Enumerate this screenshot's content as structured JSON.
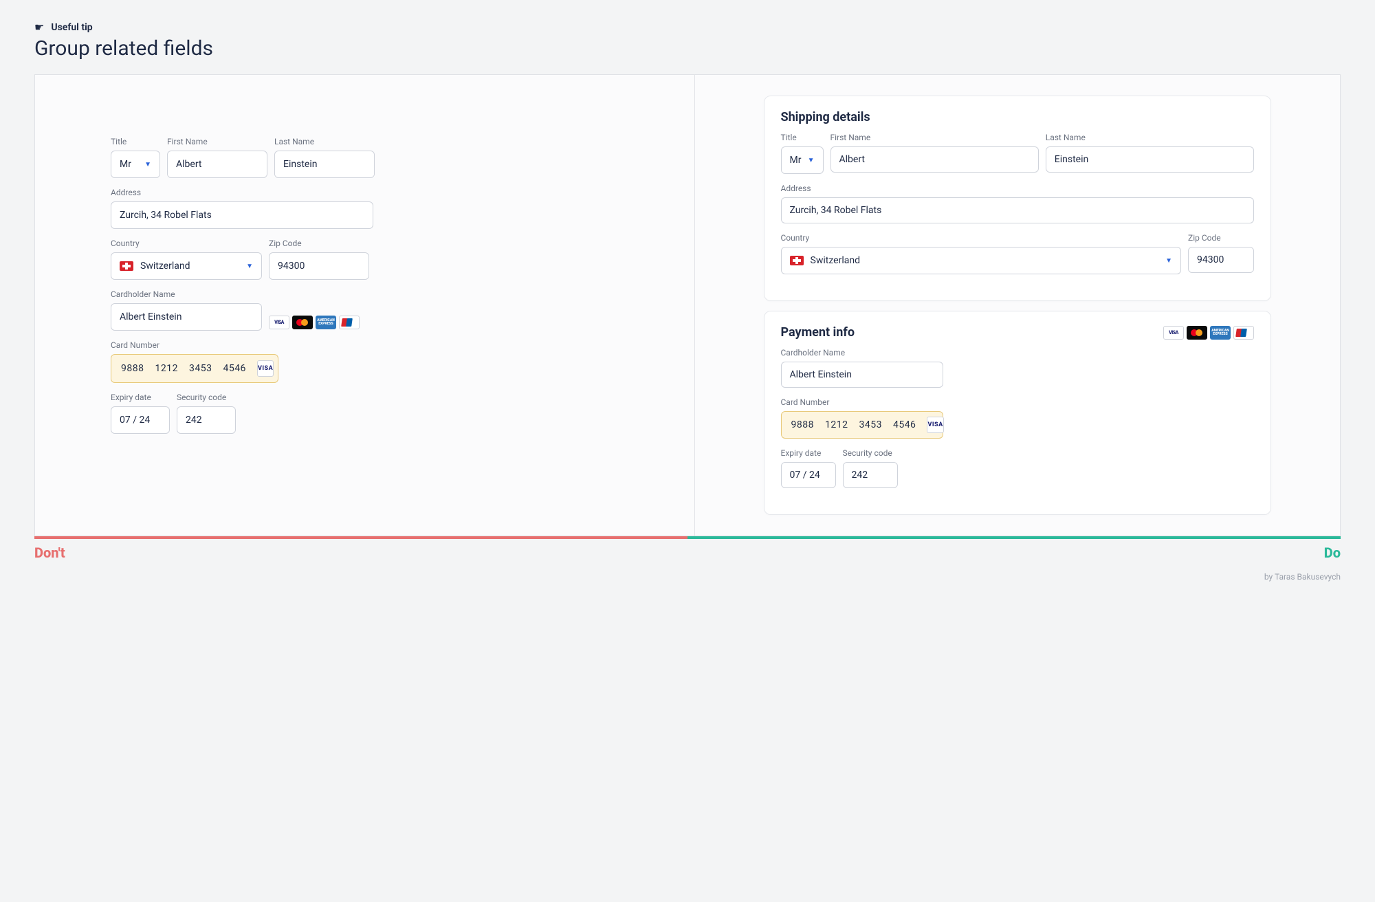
{
  "header": {
    "tip_label": "Useful tip",
    "title": "Group related fields"
  },
  "labels": {
    "dont": "Don't",
    "do": "Do"
  },
  "form": {
    "title_label": "Title",
    "title_value": "Mr",
    "first_name_label": "First Name",
    "first_name_value": "Albert",
    "last_name_label": "Last Name",
    "last_name_value": "Einstein",
    "address_label": "Address",
    "address_value": "Zurcih, 34 Robel Flats",
    "country_label": "Country",
    "country_value": "Switzerland",
    "zip_label": "Zip Code",
    "zip_value": "94300",
    "cardholder_label": "Cardholder Name",
    "cardholder_value": "Albert Einstein",
    "cardnumber_label": "Card Number",
    "cardnumber_g1": "9888",
    "cardnumber_g2": "1212",
    "cardnumber_g3": "3453",
    "cardnumber_g4": "4546",
    "expiry_label": "Expiry date",
    "expiry_value": "07 / 24",
    "security_label": "Security code",
    "security_value": "242",
    "visa_badge": "VISA",
    "amex_text": "AMERICAN EXPRESS"
  },
  "groups": {
    "shipping_title": "Shipping details",
    "payment_title": "Payment info"
  },
  "credit": "by Taras Bakusevych"
}
